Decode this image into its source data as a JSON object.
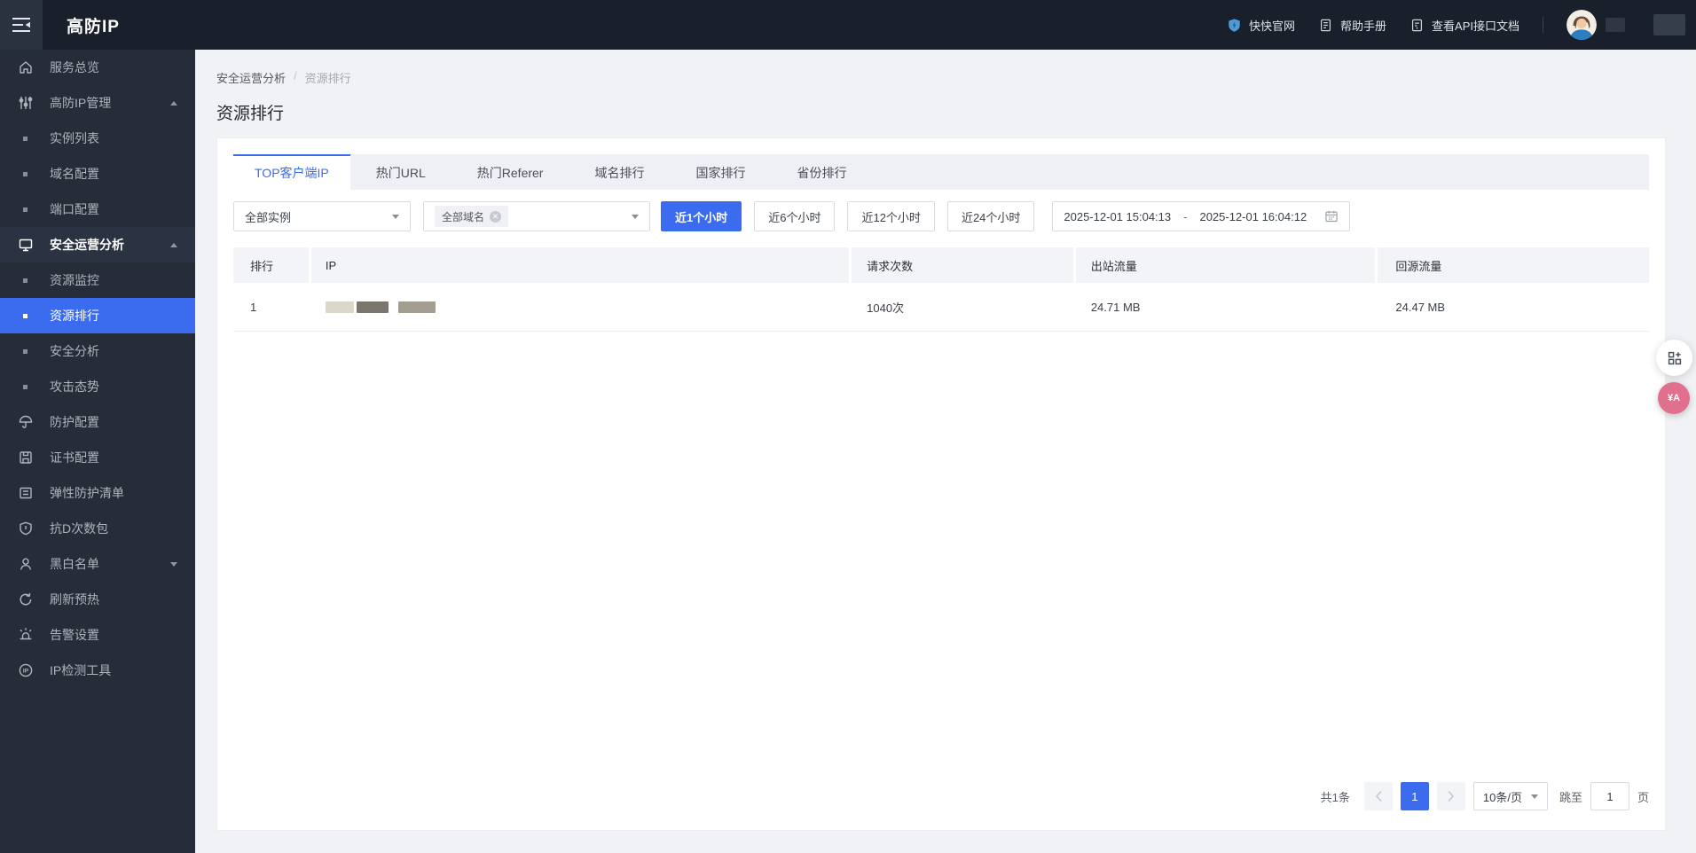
{
  "header": {
    "logo": "高防IP",
    "links": [
      {
        "label": "快快官网",
        "icon": "shield-logo-icon"
      },
      {
        "label": "帮助手册",
        "icon": "manual-icon"
      },
      {
        "label": "查看API接口文档",
        "icon": "api-doc-icon"
      }
    ]
  },
  "sidebar": {
    "items": [
      {
        "label": "服务总览",
        "icon": "home-icon"
      },
      {
        "label": "高防IP管理",
        "icon": "sliders-icon",
        "expanded": true
      },
      {
        "label": "实例列表",
        "sub": true
      },
      {
        "label": "域名配置",
        "sub": true
      },
      {
        "label": "端口配置",
        "sub": true
      },
      {
        "label": "安全运营分析",
        "icon": "monitor-icon",
        "expanded": true,
        "active_parent": true
      },
      {
        "label": "资源监控",
        "sub": true
      },
      {
        "label": "资源排行",
        "sub": true,
        "selected": true
      },
      {
        "label": "安全分析",
        "sub": true
      },
      {
        "label": "攻击态势",
        "sub": true
      },
      {
        "label": "防护配置",
        "icon": "umbrella-icon"
      },
      {
        "label": "证书配置",
        "icon": "certificate-icon"
      },
      {
        "label": "弹性防护清单",
        "icon": "list-icon"
      },
      {
        "label": "抗D次数包",
        "icon": "shield-icon"
      },
      {
        "label": "黑白名单",
        "icon": "user-icon",
        "collapsed": true
      },
      {
        "label": "刷新预热",
        "icon": "refresh-icon"
      },
      {
        "label": "告警设置",
        "icon": "alarm-icon"
      },
      {
        "label": "IP检测工具",
        "icon": "ip-tool-icon"
      }
    ]
  },
  "breadcrumb": {
    "parent": "安全运营分析",
    "separator": "/",
    "current": "资源排行"
  },
  "page": {
    "title": "资源排行"
  },
  "tabs": [
    {
      "label": "TOP客户端IP",
      "active": true
    },
    {
      "label": "热门URL"
    },
    {
      "label": "热门Referer"
    },
    {
      "label": "域名排行"
    },
    {
      "label": "国家排行"
    },
    {
      "label": "省份排行"
    }
  ],
  "filters": {
    "instance_select": "全部实例",
    "domain_tag": "全部域名",
    "time_buttons": [
      {
        "label": "近1个小时",
        "active": true
      },
      {
        "label": "近6个小时"
      },
      {
        "label": "近12个小时"
      },
      {
        "label": "近24个小时"
      }
    ],
    "date_start": "2025-12-01 15:04:13",
    "date_separator": "-",
    "date_end": "2025-12-01 16:04:12"
  },
  "table": {
    "columns": [
      "排行",
      "IP",
      "请求次数",
      "出站流量",
      "回源流量"
    ],
    "rows": [
      {
        "rank": "1",
        "ip_masked": true,
        "requests": "1040次",
        "outbound": "24.71 MB",
        "origin": "24.47 MB"
      }
    ]
  },
  "pagination": {
    "total": "共1条",
    "current_page": "1",
    "page_size": "10条/页",
    "jump_label": "跳至",
    "jump_value": "1",
    "page_unit": "页"
  },
  "floaters": {
    "translate_glyph": "¥A"
  },
  "colors": {
    "accent": "#3b6cf0",
    "header_bg": "#1a202b",
    "sidebar_bg": "#262d39",
    "translate_pink": "#e0708d"
  }
}
